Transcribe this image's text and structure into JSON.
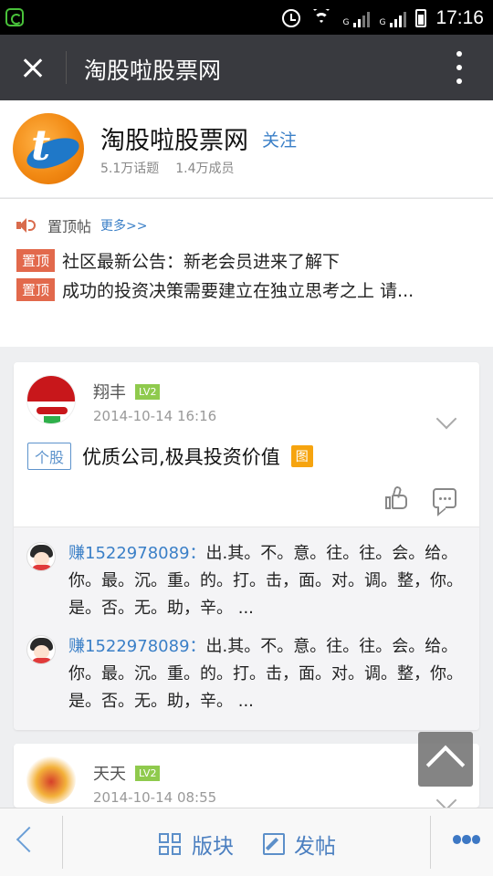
{
  "status_bar": {
    "time": "17:16",
    "network_label_1": "G",
    "network_label_2": "G"
  },
  "title_bar": {
    "title": "淘股啦股票网"
  },
  "forum": {
    "name": "淘股啦股票网",
    "follow_label": "关注",
    "topics": "5.1万话题",
    "members": "1.4万成员"
  },
  "pinned": {
    "label": "置顶帖",
    "more": "更多>>",
    "items": [
      {
        "tag": "置顶",
        "text": "社区最新公告：新老会员进来了解下"
      },
      {
        "tag": "置顶",
        "text": "成功的投资决策需要建立在独立思考之上 请..."
      }
    ]
  },
  "posts": [
    {
      "author": "翔丰",
      "level": "LV2",
      "time": "2014-10-14 16:16",
      "tag": "个股",
      "title": "优质公司,极具投资价值",
      "image_tag": "图",
      "replies": [
        {
          "user": "赚1522978089：",
          "text": "出.其。不。意。往。往。会。给。你。最。沉。重。的。打。击，面。对。调。整，你。是。否。无。助，辛。 ..."
        },
        {
          "user": "赚1522978089：",
          "text": "出.其。不。意。往。往。会。给。你。最。沉。重。的。打。击，面。对。调。整，你。是。否。无。助，辛。 ..."
        }
      ]
    },
    {
      "author": "天天",
      "level": "LV2",
      "time": "2014-10-14 08:55"
    }
  ],
  "bottom_bar": {
    "section_label": "版块",
    "post_label": "发帖"
  }
}
